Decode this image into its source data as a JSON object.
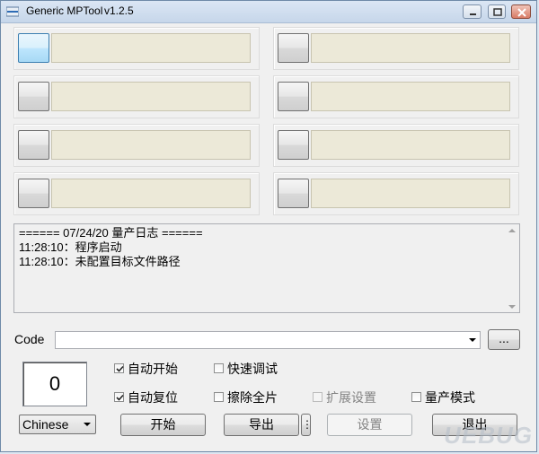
{
  "window": {
    "title": "Generic MPTool",
    "version": "v1.2.5"
  },
  "ports": [
    {
      "status": ""
    },
    {
      "status": ""
    },
    {
      "status": ""
    },
    {
      "status": ""
    },
    {
      "status": ""
    },
    {
      "status": ""
    },
    {
      "status": ""
    },
    {
      "status": ""
    }
  ],
  "log": {
    "lines": [
      "====== 07/24/20 量产日志 ======",
      "11:28:10：程序启动",
      "11:28:10：未配置目标文件路径"
    ]
  },
  "code": {
    "label": "Code",
    "value": "",
    "browse_label": "..."
  },
  "counter": {
    "value": "0"
  },
  "options": {
    "auto_start": {
      "label": "自动开始",
      "checked": true
    },
    "fast_debug": {
      "label": "快速调试",
      "checked": false
    },
    "auto_reset": {
      "label": "自动复位",
      "checked": true
    },
    "erase_full": {
      "label": "擦除全片",
      "checked": false
    },
    "ext_settings": {
      "label": "扩展设置",
      "checked": false,
      "disabled": true
    },
    "mp_mode": {
      "label": "量产模式",
      "checked": false
    }
  },
  "language": {
    "selected": "Chinese"
  },
  "buttons": {
    "start": "开始",
    "export": "导出",
    "export_more": "⋮",
    "settings": "设置",
    "exit": "退出"
  },
  "watermark": "UEBUG"
}
